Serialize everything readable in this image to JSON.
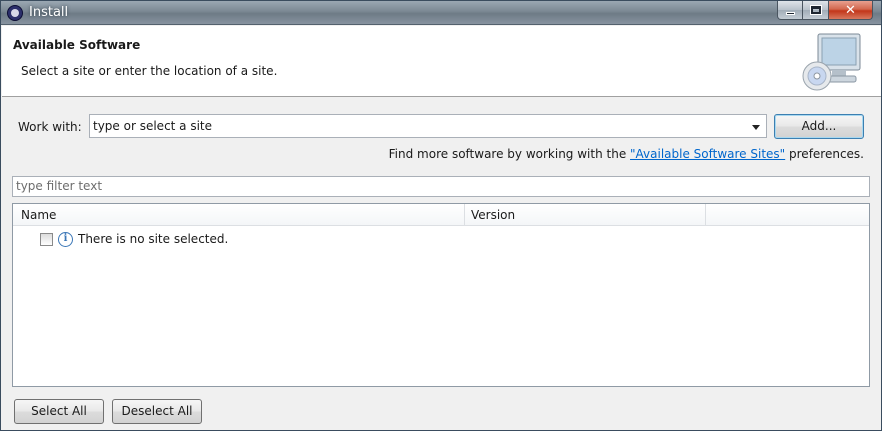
{
  "window": {
    "title": "Install"
  },
  "header": {
    "title": "Available Software",
    "description": "Select a site or enter the location of a site."
  },
  "work_with": {
    "label": "Work with:",
    "value": "type or select a site",
    "add_button": "Add..."
  },
  "more_software": {
    "prefix": "Find more software by working with the ",
    "link": "\"Available Software Sites\"",
    "suffix": " preferences."
  },
  "filter": {
    "placeholder": "type filter text"
  },
  "table": {
    "columns": [
      "Name",
      "Version"
    ],
    "rows": [
      {
        "checked": false,
        "icon": "info-icon",
        "text": "There is no site selected."
      }
    ]
  },
  "buttons": {
    "select_all": "Select All",
    "deselect_all": "Deselect All"
  }
}
